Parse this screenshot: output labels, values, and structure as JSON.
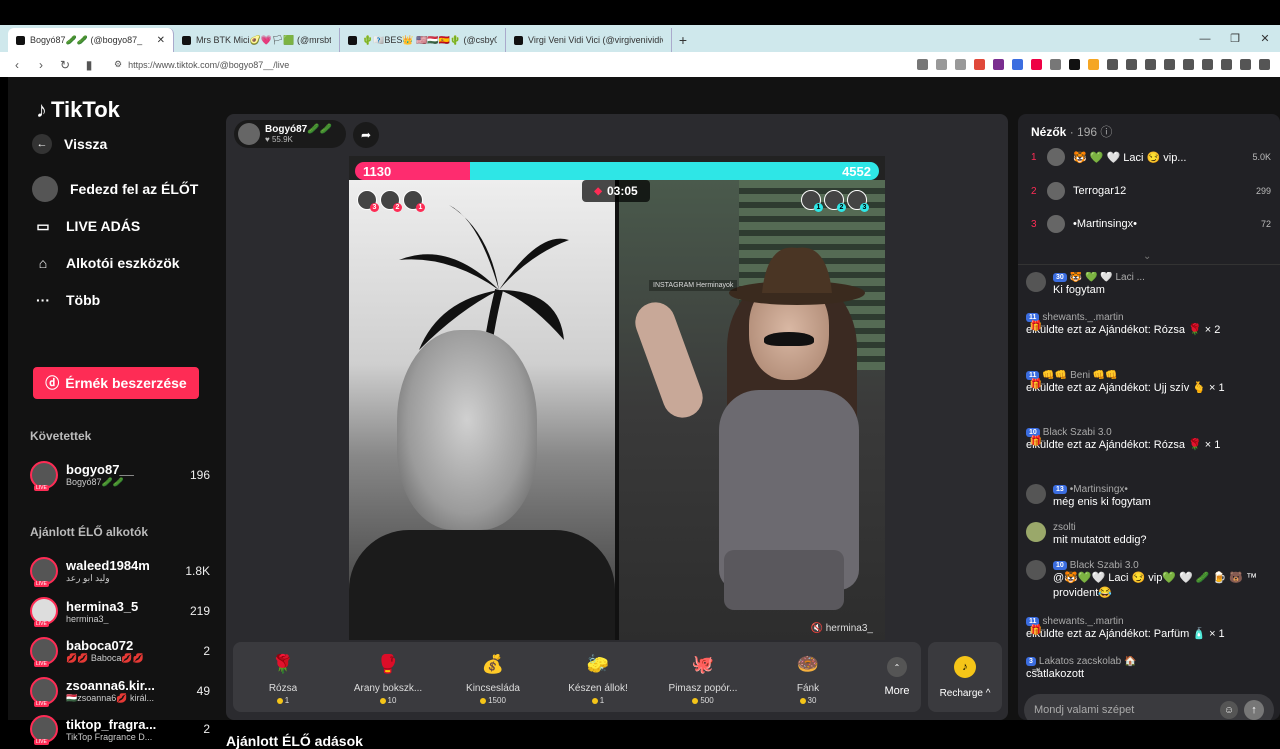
{
  "tabs": [
    {
      "title": "Bogyó87🥒🥒 (@bogyo87_",
      "close": "✕"
    },
    {
      "title": "Mrs BTK Mici🥑💗🏳🟩 (@mrsbtk) F",
      "close": ""
    },
    {
      "title": "🌵🇰🇸BES👑 🇺🇸🇭🇺🇪🇸🌵 (@csby01",
      "close": ""
    },
    {
      "title": "Virgi Veni Vidi Vici (@virgivenividivici",
      "close": ""
    }
  ],
  "address": {
    "url": "https://www.tiktok.com/@bogyo87__/live"
  },
  "sidebar": {
    "logo": "TikTok",
    "back": "Vissza",
    "explore": "Fedezd fel az ÉLŐT",
    "live": "LIVE ADÁS",
    "creator_tools": "Alkotói eszközök",
    "more": "Több",
    "coins_button": "Érmék beszerzése",
    "following_heading": "Követettek",
    "following": [
      {
        "name": "bogyo87__",
        "sub": "Bogyó87🥒🥒",
        "count": "196"
      }
    ],
    "recommended_heading": "Ajánlott ÉLŐ alkotók",
    "recommended": [
      {
        "name": "waleed1984m",
        "sub": "وليد ابو رعد",
        "count": "1.8K"
      },
      {
        "name": "hermina3_5",
        "sub": "hermina3_",
        "count": "219"
      },
      {
        "name": "baboca072",
        "sub": "💋💋 Baboca💋💋",
        "count": "2"
      },
      {
        "name": "zsoanna6.kir...",
        "sub": "🇭🇺zsoanna6💋 királ...",
        "count": "49"
      },
      {
        "name": "tiktop_fragra...",
        "sub": "TikTop Fragrance D...",
        "count": "2"
      }
    ]
  },
  "stream": {
    "host_name": "Bogyó87🥒🥒",
    "host_likes": "♥ 55.9K",
    "score_left": "1130",
    "score_right": "4552",
    "score_left_fraction": 0.22,
    "timer": "03:05",
    "watermark": "hermina3_",
    "instagram_tag": "INSTAGRAM Herminayok",
    "supporters_left_ranks": [
      "3",
      "2",
      "1"
    ],
    "supporters_right_ranks": [
      "1",
      "2",
      "3"
    ]
  },
  "gifts": [
    {
      "name": "Rózsa",
      "price": "1",
      "icon": "🌹"
    },
    {
      "name": "Arany bokszk...",
      "price": "10",
      "icon": "🥊"
    },
    {
      "name": "Kincsesláda",
      "price": "1500",
      "icon": "💰"
    },
    {
      "name": "Készen állok!",
      "price": "1",
      "icon": "🧽"
    },
    {
      "name": "Pimasz popór...",
      "price": "500",
      "icon": "🐙"
    },
    {
      "name": "Fánk",
      "price": "30",
      "icon": "🍩"
    }
  ],
  "gift_more": "More",
  "recharge": "Recharge ^",
  "below_title": "Ajánlott ÉLŐ adások",
  "chat": {
    "viewers_label": "Nézők",
    "viewers_count": "· 196",
    "top": [
      {
        "rank": "1",
        "name": "🐯 💚 🤍 Laci 😏 vip...",
        "score": "5.0K"
      },
      {
        "rank": "2",
        "name": "Terrogar12",
        "score": "299"
      },
      {
        "rank": "3",
        "name": "•Martinsingx•",
        "score": "72"
      }
    ],
    "messages": [
      {
        "badge": "30",
        "header": "🐯 💚 🤍 Laci ...",
        "text": "Ki fogytam"
      },
      {
        "badge": "11",
        "header": "shewants._.martin",
        "text": "elküldte ezt az Ajándékot: Rózsa 🌹 × 2"
      },
      {
        "badge": "11",
        "header": "👊👊 Beni 👊👊",
        "text": "elküldte ezt az Ajándékot: Ujj szív 🫰 × 1"
      },
      {
        "badge": "10",
        "header": "Black Szabi 3.0",
        "text": "elküldte ezt az Ajándékot: Rózsa 🌹 × 1"
      },
      {
        "badge": "13",
        "header": "•Martinsingx•",
        "text": "még enis ki fogytam"
      },
      {
        "badge": "",
        "header": "zsolti",
        "text": "mit mutatott eddig?"
      },
      {
        "badge": "10",
        "header": "Black Szabi 3.0",
        "text": "@🐯💚🤍 Laci 😏 vip💚 🤍 🥒 🍺 🐻 ™ provident😂"
      },
      {
        "badge": "11",
        "header": "shewants._.martin",
        "text": "elküldte ezt az Ajándékot: Parfüm 🧴 × 1"
      },
      {
        "badge": "3",
        "header": "Lakatos zacskolab 🏠",
        "text": "csatlakozott"
      }
    ],
    "input_placeholder": "Mondj valami szépet"
  }
}
